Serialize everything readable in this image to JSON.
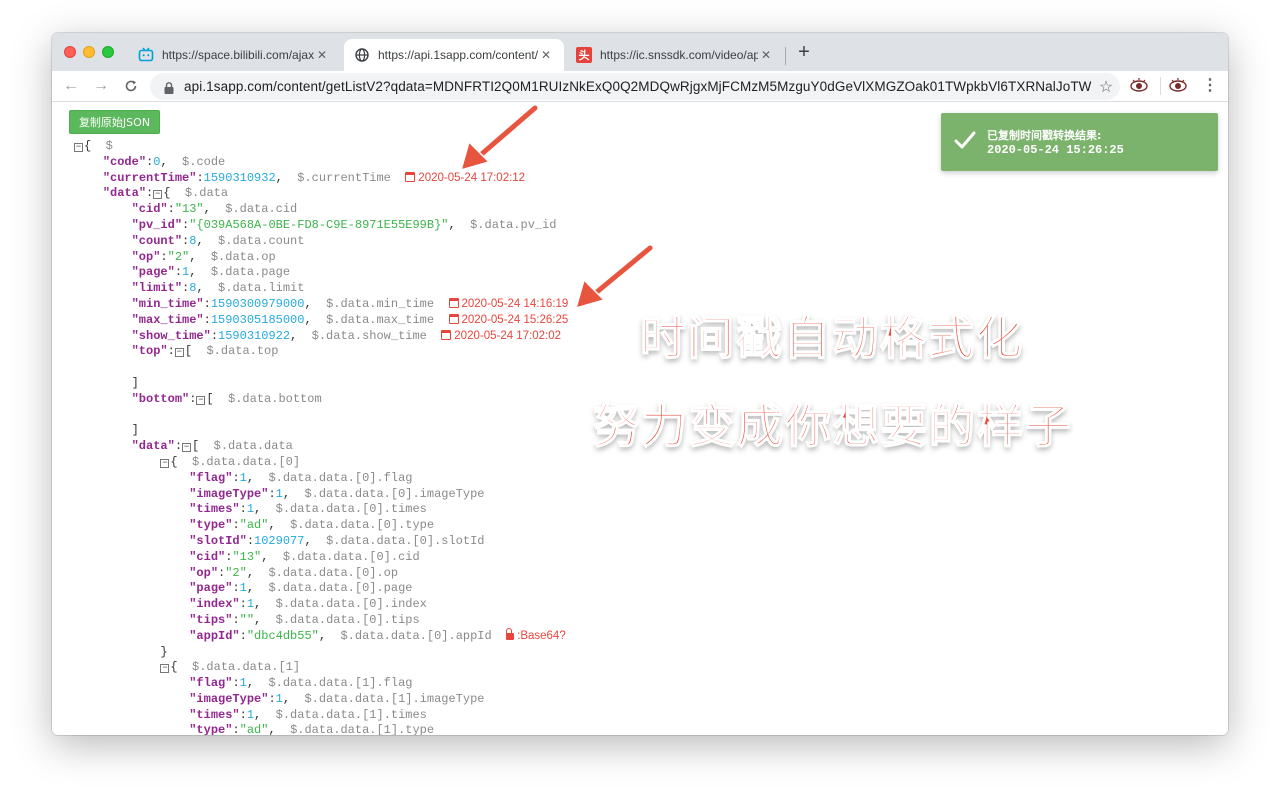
{
  "browser": {
    "tabs": [
      {
        "title": "https://space.bilibili.com/ajax/m",
        "favicon": "bilibili-tv-icon",
        "active": false
      },
      {
        "title": "https://api.1sapp.com/content/",
        "favicon": "globe-icon",
        "active": true
      },
      {
        "title": "https://ic.snssdk.com/video/ap",
        "favicon": "toutiao-icon",
        "active": false
      }
    ],
    "toutiao_glyph": "头",
    "new_tab": "+",
    "url": "api.1sapp.com/content/getListV2?qdata=MDNFRTI2Q0M1RUIzNkExQ0Q2MDQwRjgxMjFCMzM5MzguY0dGeVlXMGZOak01TWpkbVl6TXRNalJoTW..."
  },
  "toolbar": {
    "copy_label": "复制原始JSON"
  },
  "toast": {
    "title": "已复制时间戳转换结果:",
    "value": "2020-05-24 15:26:25"
  },
  "promo": {
    "line1": "时间戳自动格式化",
    "line2": "努力变成你想要的样子"
  },
  "json_view": {
    "root_brace": "{",
    "root_path": "$",
    "code": {
      "key": "\"code\"",
      "value": "0",
      "path": "$.code"
    },
    "currentTime": {
      "key": "\"currentTime\"",
      "value": "1590310932",
      "path": "$.currentTime",
      "stamp": "2020-05-24 17:02:12"
    },
    "data_key": "\"data\"",
    "data_path": "$.data",
    "cid": {
      "key": "\"cid\"",
      "value": "\"13\"",
      "path": "$.data.cid"
    },
    "pv_id": {
      "key": "\"pv_id\"",
      "value": "\"{039A568A-0BE-FD8-C9E-8971E55E99B}\"",
      "path": "$.data.pv_id"
    },
    "count": {
      "key": "\"count\"",
      "value": "8",
      "path": "$.data.count"
    },
    "op": {
      "key": "\"op\"",
      "value": "\"2\"",
      "path": "$.data.op"
    },
    "page": {
      "key": "\"page\"",
      "value": "1",
      "path": "$.data.page"
    },
    "limit": {
      "key": "\"limit\"",
      "value": "8",
      "path": "$.data.limit"
    },
    "min_time": {
      "key": "\"min_time\"",
      "value": "1590300979000",
      "path": "$.data.min_time",
      "stamp": "2020-05-24 14:16:19"
    },
    "max_time": {
      "key": "\"max_time\"",
      "value": "1590305185000",
      "path": "$.data.max_time",
      "stamp": "2020-05-24 15:26:25"
    },
    "show_time": {
      "key": "\"show_time\"",
      "value": "1590310922",
      "path": "$.data.show_time",
      "stamp": "2020-05-24 17:02:02"
    },
    "top": {
      "key": "\"top\"",
      "path": "$.data.top"
    },
    "bottom": {
      "key": "\"bottom\"",
      "path": "$.data.bottom"
    },
    "data_data": {
      "key": "\"data\"",
      "path": "$.data.data"
    },
    "item0": {
      "path": "$.data.data.[0]",
      "flag": {
        "key": "\"flag\"",
        "value": "1",
        "path": "$.data.data.[0].flag"
      },
      "imageType": {
        "key": "\"imageType\"",
        "value": "1",
        "path": "$.data.data.[0].imageType"
      },
      "times": {
        "key": "\"times\"",
        "value": "1",
        "path": "$.data.data.[0].times"
      },
      "type": {
        "key": "\"type\"",
        "value": "\"ad\"",
        "path": "$.data.data.[0].type"
      },
      "slotId": {
        "key": "\"slotId\"",
        "value": "1029077",
        "path": "$.data.data.[0].slotId"
      },
      "cid": {
        "key": "\"cid\"",
        "value": "\"13\"",
        "path": "$.data.data.[0].cid"
      },
      "op": {
        "key": "\"op\"",
        "value": "\"2\"",
        "path": "$.data.data.[0].op"
      },
      "page": {
        "key": "\"page\"",
        "value": "1",
        "path": "$.data.data.[0].page"
      },
      "index": {
        "key": "\"index\"",
        "value": "1",
        "path": "$.data.data.[0].index"
      },
      "tips": {
        "key": "\"tips\"",
        "value": "\"\"",
        "path": "$.data.data.[0].tips"
      },
      "appId": {
        "key": "\"appId\"",
        "value": "\"dbc4db55\"",
        "path": "$.data.data.[0].appId",
        "hint": "Base64?"
      }
    },
    "item1": {
      "path": "$.data.data.[1]",
      "flag": {
        "key": "\"flag\"",
        "value": "1",
        "path": "$.data.data.[1].flag"
      },
      "imageType": {
        "key": "\"imageType\"",
        "value": "1",
        "path": "$.data.data.[1].imageType"
      },
      "times": {
        "key": "\"times\"",
        "value": "1",
        "path": "$.data.data.[1].times"
      },
      "type": {
        "key": "\"type\"",
        "value": "\"ad\"",
        "path": "$.data.data.[1].type"
      }
    }
  },
  "colors": {
    "key": "#92278f",
    "number": "#25aae2",
    "string": "#3ab54a",
    "path": "#8a8a8a",
    "timestamp": "#e8463c",
    "toast_bg": "#7bb36d",
    "copy_button": "#5cb85c",
    "promo_text": "#ea4a3a"
  }
}
